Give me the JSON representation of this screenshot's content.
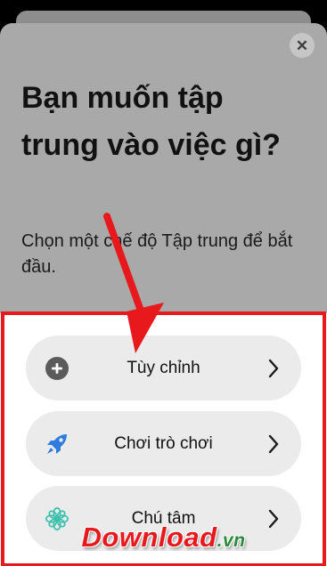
{
  "sheet": {
    "close_glyph": "✕",
    "title": "Bạn muốn tập trung vào việc gì?",
    "subtitle": "Chọn một chế độ Tập trung để bắt đầu."
  },
  "options": [
    {
      "label": "Tùy chỉnh",
      "icon": "plus-circle-icon"
    },
    {
      "label": "Chơi trò chơi",
      "icon": "rocket-icon"
    },
    {
      "label": "Chú tâm",
      "icon": "flower-icon"
    }
  ],
  "watermark": {
    "name": "Download",
    "tld": ".vn"
  },
  "colors": {
    "highlight": "#e8191c",
    "rocket": "#2f7be0",
    "flower": "#3bbfad"
  }
}
